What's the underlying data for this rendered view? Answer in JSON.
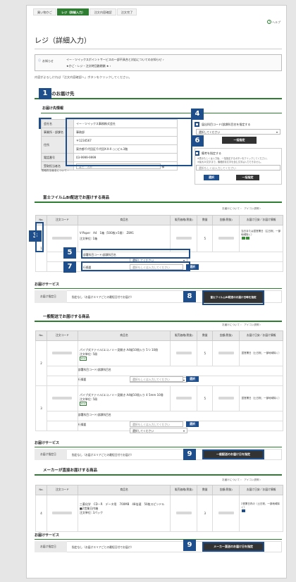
{
  "steps": [
    "買い物かご",
    "レジ（詳細入力）",
    "注文内容確認",
    "注文完了"
  ],
  "help": "ヘルプ",
  "title": "レジ（詳細入力）",
  "notice": {
    "label": "お知らせ",
    "line1": "イー・ツイックスポイントサービスの一部不具合と対応についてのお知らせ ›",
    "line2": "★かご・レジ・注文時回路閉鎖 ★ ›"
  },
  "instruction": "内容がよろしければ「注文内容確認へ」ボタンをクリックしてください。",
  "delivery": {
    "title": "通常のお届け先",
    "info_title": "お届け先情報",
    "rows": [
      {
        "k": "会社名",
        "v": "イー・ツイックス事務株式会社"
      },
      {
        "k": "事業所・部課名",
        "v": "事務部"
      },
      {
        "k": "住所",
        "v": "〒1234567"
      },
      {
        "k": "",
        "v": "東京都千代田区千代田X-X-X ○○ビル3階"
      },
      {
        "k": "電話番号",
        "v": "03-9999-9999"
      },
      {
        "k": "受取担当者名",
        "v": "富士　太郎",
        "v2": "様"
      }
    ],
    "change_link": "受取担当者名について ›",
    "fee_label": "届出科目コード/部課科目名を指定する",
    "fee_select": "選択してください",
    "bulk_btn": "一括指定",
    "memo_label": "備考を指定する",
    "memo_note1": "※表示もしくは入力後、一括指定するボタンをクリックしてください。",
    "memo_note2": "※最大20文字まで。機種依存文字を含む文字は入力できません。",
    "memo_placeholder": "選択もしくは入力してください",
    "select_btn": "選択",
    "bulk_btn2": "一括指定"
  },
  "fuji": {
    "title": "富士フイルムBI配送でお届けする商品",
    "links": "お届けについて ›　アイコン説明 ›",
    "headers": [
      "No.",
      "注文コード",
      "商品名",
      "販売価格(税抜)",
      "数量",
      "金額(税抜)",
      "お届け日安／お届け情報"
    ],
    "item": {
      "no": "1",
      "name": "V-Paper　A4　1箱（500枚×5冊）　Z891",
      "sub": "注文単位: 1箱",
      "qty": "5",
      "info": "当日または翌営業日（主日祝、一部地域除く）"
    },
    "fee_label": "部署科目コード/部課科目名",
    "fee_select": "選択してください",
    "memo_label": "行摘要",
    "memo_placeholder": "選択もしくは入力してください",
    "select_btn": "選択",
    "service_title": "お届けサービス",
    "service_key": "お届け指定日",
    "service_val": "指定なし（お届けエリアごとの最短日付でお届け）",
    "date_btn": "富士フイルムBI配送のお届け日時を指定"
  },
  "general": {
    "title": "一般配送でお届けする商品",
    "links": "お届けについて ›　アイコン説明 ›",
    "headers": [
      "No.",
      "注文コード",
      "商品名",
      "販売価格(税抜)",
      "数量",
      "金額(税抜)",
      "お届け日安／お届け情報"
    ],
    "items": [
      {
        "no": "2",
        "name": "パイプ式ファイル/エコノミー見開き A4縦10冊入り 5つ 10冊",
        "sub": "注文単位: 5冊",
        "qty": "5",
        "info": "翌営業日（土日祝、一部地域除く）"
      },
      {
        "no": "3",
        "name": "パイプ式ファイル/エコノミー見開き A4縦10冊入り 4 5mm 10冊",
        "sub": "注文単位: 5冊",
        "qty": "5",
        "info": "翌営業日（土日祝、一部地域除く）"
      }
    ],
    "fee_select": "選択してください",
    "memo_placeholder": "選択もしくは入力してください",
    "fee_label": "部署科目コード/部課科目名",
    "memo_label": "行摘要",
    "select_btn": "選択",
    "service_title": "お届けサービス",
    "service_key": "お届け指定日",
    "service_val": "指定なし（お届けエリアごとの最短日付でお届け）",
    "date_btn": "一般配送のお届け日を指定"
  },
  "maker": {
    "title": "メーカーが直接お届けする商品",
    "links": "お届けについて ›　アイコン説明 ›",
    "headers": [
      "No.",
      "注文コード",
      "商品名",
      "販売価格(税抜)",
      "数量",
      "金額(税抜)",
      "お届け日安／お届け情報"
    ],
    "item": {
      "no": "4",
      "name": "三菱化学　CD－R　データ用　700MB　48倍速　50枚スピンドル■2営業日内箱",
      "sub": "注文単位: 3パック",
      "qty": "3",
      "info": "2営業日内の（土日祝、一部地域除く）"
    },
    "service_title": "お届けサービス",
    "service_key": "お届け指定日",
    "service_val": "指定なし（お届けエリアごとの最短日付でお届け）",
    "date_btn": "メーカー直送のお届け日を指定"
  },
  "markers": [
    "1",
    "2",
    "3",
    "4",
    "5",
    "6",
    "7",
    "8",
    "9",
    "9"
  ]
}
